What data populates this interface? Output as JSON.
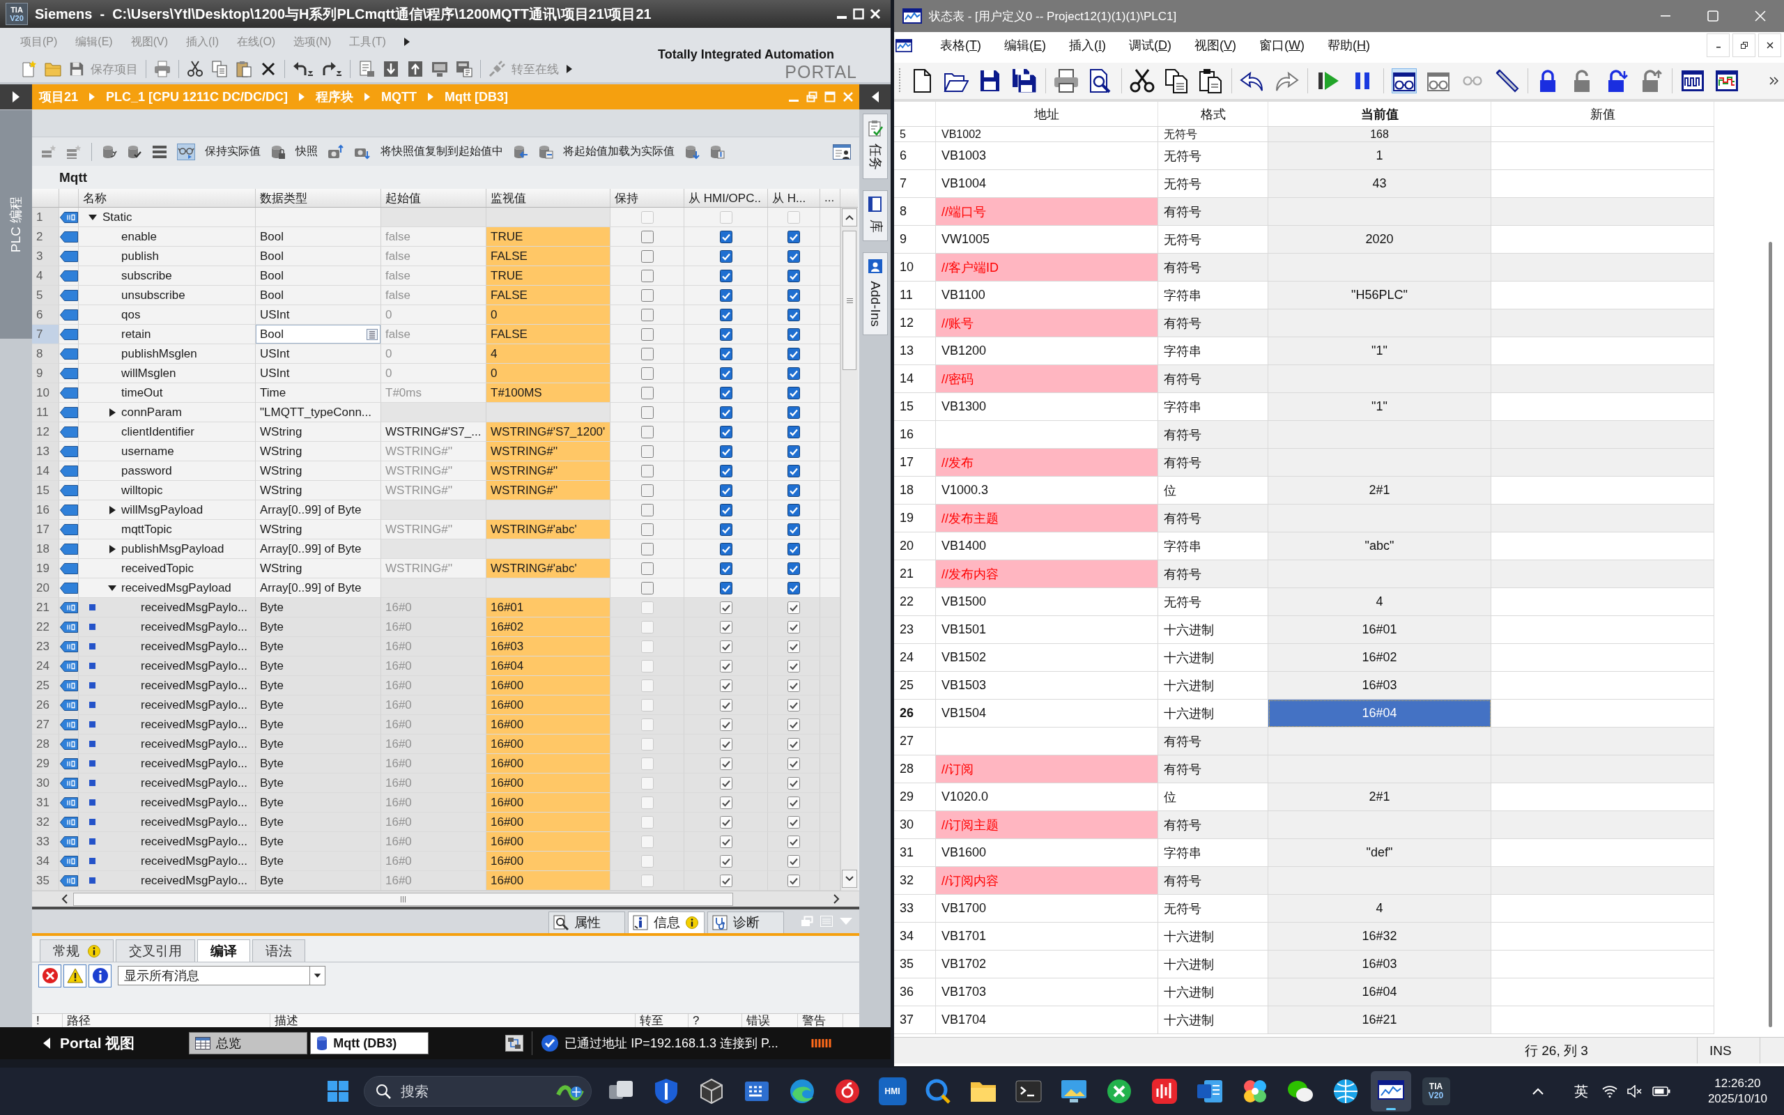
{
  "left_window": {
    "logo_lines": [
      "TIA",
      "V20"
    ],
    "title": "Siemens  -  C:\\Users\\Ytl\\Desktop\\1200与H系列PLCmqtt通信\\程序\\1200MQTT通讯\\项目21\\项目21",
    "menu": [
      "项目(P)",
      "编辑(E)",
      "视图(V)",
      "插入(I)",
      "在线(O)",
      "选项(N)",
      "工具(T)"
    ],
    "toolbar": {
      "save_project": "保存项目",
      "go_online": "转至在线"
    },
    "brand": [
      "Totally Integrated Automation",
      "PORTAL"
    ],
    "side_tab": "PLC 编程",
    "breadcrumb": [
      "项目21",
      "PLC_1 [CPU 1211C DC/DC/DC]",
      "程序块",
      "MQTT",
      "Mqtt [DB3]"
    ],
    "task_tabs": [
      "任务",
      "库",
      "Add-Ins"
    ],
    "db_toolbar": {
      "monitoring": true,
      "labels": [
        "保持实际值",
        "快照",
        "将快照值复制到起始值中",
        "将起始值加载为实际值"
      ]
    },
    "block_name": "Mqtt",
    "table": {
      "columns": [
        "名称",
        "数据类型",
        "起始值",
        "监视值",
        "保持",
        "从 HMI/OPC..",
        "从 H...",
        "..."
      ],
      "rows": [
        {
          "number": "1",
          "name": "Static",
          "expanded": true,
          "retain": false,
          "from_hmi_opc": false,
          "from_h": false,
          "editable": false,
          "selected": false,
          "children": [
            {
              "number": "2",
              "name": "enable",
              "data_type": "Bool",
              "start": "false",
              "start_default": true,
              "monitor": "TRUE",
              "retain": false,
              "from_hmi_opc": true,
              "from_h": true,
              "editable": true,
              "selected": false
            },
            {
              "number": "3",
              "name": "publish",
              "data_type": "Bool",
              "start": "false",
              "start_default": true,
              "monitor": "FALSE",
              "retain": false,
              "from_hmi_opc": true,
              "from_h": true,
              "editable": true,
              "selected": false
            },
            {
              "number": "4",
              "name": "subscribe",
              "data_type": "Bool",
              "start": "false",
              "start_default": true,
              "monitor": "TRUE",
              "retain": false,
              "from_hmi_opc": true,
              "from_h": true,
              "editable": true,
              "selected": false
            },
            {
              "number": "5",
              "name": "unsubscribe",
              "data_type": "Bool",
              "start": "false",
              "start_default": true,
              "monitor": "FALSE",
              "retain": false,
              "from_hmi_opc": true,
              "from_h": true,
              "editable": true,
              "selected": false
            },
            {
              "number": "6",
              "name": "qos",
              "data_type": "USInt",
              "start": "0",
              "start_default": true,
              "monitor": "0",
              "retain": false,
              "from_hmi_opc": true,
              "from_h": true,
              "editable": true,
              "selected": false
            },
            {
              "number": "7",
              "name": "retain",
              "data_type": "Bool",
              "start": "false",
              "start_default": true,
              "monitor": "FALSE",
              "retain": false,
              "from_hmi_opc": true,
              "from_h": true,
              "editable": true,
              "selected": true
            },
            {
              "number": "8",
              "name": "publishMsglen",
              "data_type": "USInt",
              "start": "0",
              "start_default": true,
              "monitor": "4",
              "retain": false,
              "from_hmi_opc": true,
              "from_h": true,
              "editable": true,
              "selected": false
            },
            {
              "number": "9",
              "name": "willMsglen",
              "data_type": "USInt",
              "start": "0",
              "start_default": true,
              "monitor": "0",
              "retain": false,
              "from_hmi_opc": true,
              "from_h": true,
              "editable": true,
              "selected": false
            },
            {
              "number": "10",
              "name": "timeOut",
              "data_type": "Time",
              "start": "T#0ms",
              "start_default": true,
              "monitor": "T#100MS",
              "retain": false,
              "from_hmi_opc": true,
              "from_h": true,
              "editable": true,
              "selected": false
            },
            {
              "number": "11",
              "name": "connParam",
              "expanded": false,
              "data_type": "\"LMQTT_typeConn...",
              "retain": false,
              "from_hmi_opc": true,
              "from_h": true,
              "editable": true,
              "selected": false
            },
            {
              "number": "12",
              "name": "clientIdentifier",
              "data_type": "WString",
              "start": "WSTRING#'S7_...",
              "start_default": false,
              "monitor": "WSTRING#'S7_1200'",
              "retain": false,
              "from_hmi_opc": true,
              "from_h": true,
              "editable": true,
              "selected": false
            },
            {
              "number": "13",
              "name": "username",
              "data_type": "WString",
              "start": "WSTRING#''",
              "start_default": true,
              "monitor": "WSTRING#''",
              "retain": false,
              "from_hmi_opc": true,
              "from_h": true,
              "editable": true,
              "selected": false
            },
            {
              "number": "14",
              "name": "password",
              "data_type": "WString",
              "start": "WSTRING#''",
              "start_default": true,
              "monitor": "WSTRING#''",
              "retain": false,
              "from_hmi_opc": true,
              "from_h": true,
              "editable": true,
              "selected": false
            },
            {
              "number": "15",
              "name": "willtopic",
              "data_type": "WString",
              "start": "WSTRING#''",
              "start_default": true,
              "monitor": "WSTRING#''",
              "retain": false,
              "from_hmi_opc": true,
              "from_h": true,
              "editable": true,
              "selected": false
            },
            {
              "number": "16",
              "name": "willMsgPayload",
              "expanded": false,
              "data_type": "Array[0..99] of Byte",
              "retain": false,
              "from_hmi_opc": true,
              "from_h": true,
              "editable": true,
              "selected": false
            },
            {
              "number": "17",
              "name": "mqttTopic",
              "data_type": "WString",
              "start": "WSTRING#''",
              "start_default": true,
              "monitor": "WSTRING#'abc'",
              "retain": false,
              "from_hmi_opc": true,
              "from_h": true,
              "editable": true,
              "selected": false
            },
            {
              "number": "18",
              "name": "publishMsgPayload",
              "expanded": false,
              "data_type": "Array[0..99] of Byte",
              "retain": false,
              "from_hmi_opc": true,
              "from_h": true,
              "editable": true,
              "selected": false
            },
            {
              "number": "19",
              "name": "receivedTopic",
              "data_type": "WString",
              "start": "WSTRING#''",
              "start_default": true,
              "monitor": "WSTRING#'abc'",
              "retain": false,
              "from_hmi_opc": true,
              "from_h": true,
              "editable": true,
              "selected": false
            },
            {
              "number": "20",
              "name": "receivedMsgPayload",
              "expanded": true,
              "data_type": "Array[0..99] of Byte",
              "retain": false,
              "from_hmi_opc": true,
              "from_h": true,
              "editable": true,
              "selected": false,
              "children": [
                {
                  "number": "21",
                  "name": "receivedMsgPaylo...",
                  "data_type": "Byte",
                  "start": "16#0",
                  "start_default": true,
                  "monitor": "16#01",
                  "retain": false,
                  "from_hmi_opc": true,
                  "from_h": true,
                  "editable": false,
                  "selected": false
                },
                {
                  "number": "22",
                  "name": "receivedMsgPaylo...",
                  "data_type": "Byte",
                  "start": "16#0",
                  "start_default": true,
                  "monitor": "16#02",
                  "retain": false,
                  "from_hmi_opc": true,
                  "from_h": true,
                  "editable": false,
                  "selected": false
                },
                {
                  "number": "23",
                  "name": "receivedMsgPaylo...",
                  "data_type": "Byte",
                  "start": "16#0",
                  "start_default": true,
                  "monitor": "16#03",
                  "retain": false,
                  "from_hmi_opc": true,
                  "from_h": true,
                  "editable": false,
                  "selected": false
                },
                {
                  "number": "24",
                  "name": "receivedMsgPaylo...",
                  "data_type": "Byte",
                  "start": "16#0",
                  "start_default": true,
                  "monitor": "16#04",
                  "retain": false,
                  "from_hmi_opc": true,
                  "from_h": true,
                  "editable": false,
                  "selected": false
                },
                {
                  "number": "25",
                  "name": "receivedMsgPaylo...",
                  "data_type": "Byte",
                  "start": "16#0",
                  "start_default": true,
                  "monitor": "16#00",
                  "retain": false,
                  "from_hmi_opc": true,
                  "from_h": true,
                  "editable": false,
                  "selected": false
                },
                {
                  "number": "26",
                  "name": "receivedMsgPaylo...",
                  "data_type": "Byte",
                  "start": "16#0",
                  "start_default": true,
                  "monitor": "16#00",
                  "retain": false,
                  "from_hmi_opc": true,
                  "from_h": true,
                  "editable": false,
                  "selected": false
                },
                {
                  "number": "27",
                  "name": "receivedMsgPaylo...",
                  "data_type": "Byte",
                  "start": "16#0",
                  "start_default": true,
                  "monitor": "16#00",
                  "retain": false,
                  "from_hmi_opc": true,
                  "from_h": true,
                  "editable": false,
                  "selected": false
                },
                {
                  "number": "28",
                  "name": "receivedMsgPaylo...",
                  "data_type": "Byte",
                  "start": "16#0",
                  "start_default": true,
                  "monitor": "16#00",
                  "retain": false,
                  "from_hmi_opc": true,
                  "from_h": true,
                  "editable": false,
                  "selected": false
                },
                {
                  "number": "29",
                  "name": "receivedMsgPaylo...",
                  "data_type": "Byte",
                  "start": "16#0",
                  "start_default": true,
                  "monitor": "16#00",
                  "retain": false,
                  "from_hmi_opc": true,
                  "from_h": true,
                  "editable": false,
                  "selected": false
                },
                {
                  "number": "30",
                  "name": "receivedMsgPaylo...",
                  "data_type": "Byte",
                  "start": "16#0",
                  "start_default": true,
                  "monitor": "16#00",
                  "retain": false,
                  "from_hmi_opc": true,
                  "from_h": true,
                  "editable": false,
                  "selected": false
                },
                {
                  "number": "31",
                  "name": "receivedMsgPaylo...",
                  "data_type": "Byte",
                  "start": "16#0",
                  "start_default": true,
                  "monitor": "16#00",
                  "retain": false,
                  "from_hmi_opc": true,
                  "from_h": true,
                  "editable": false,
                  "selected": false
                },
                {
                  "number": "32",
                  "name": "receivedMsgPaylo...",
                  "data_type": "Byte",
                  "start": "16#0",
                  "start_default": true,
                  "monitor": "16#00",
                  "retain": false,
                  "from_hmi_opc": true,
                  "from_h": true,
                  "editable": false,
                  "selected": false
                },
                {
                  "number": "33",
                  "name": "receivedMsgPaylo...",
                  "data_type": "Byte",
                  "start": "16#0",
                  "start_default": true,
                  "monitor": "16#00",
                  "retain": false,
                  "from_hmi_opc": true,
                  "from_h": true,
                  "editable": false,
                  "selected": false
                },
                {
                  "number": "34",
                  "name": "receivedMsgPaylo...",
                  "data_type": "Byte",
                  "start": "16#0",
                  "start_default": true,
                  "monitor": "16#00",
                  "retain": false,
                  "from_hmi_opc": true,
                  "from_h": true,
                  "editable": false,
                  "selected": false
                },
                {
                  "number": "35",
                  "name": "receivedMsgPaylo...",
                  "data_type": "Byte",
                  "start": "16#0",
                  "start_default": true,
                  "monitor": "16#00",
                  "retain": false,
                  "from_hmi_opc": true,
                  "from_h": true,
                  "editable": false,
                  "selected": false
                }
              ]
            }
          ]
        }
      ]
    },
    "inspector": {
      "tabs": [
        {
          "label": "属性",
          "selected": false,
          "badge": false
        },
        {
          "label": "信息",
          "selected": true,
          "badge": true
        },
        {
          "label": "诊断",
          "selected": false,
          "badge": false
        }
      ],
      "subtabs": [
        {
          "label": "常规",
          "selected": false,
          "badge": true
        },
        {
          "label": "交叉引用",
          "selected": false,
          "badge": false
        },
        {
          "label": "编译",
          "selected": true,
          "badge": false
        },
        {
          "label": "语法",
          "selected": false,
          "badge": false
        }
      ],
      "filter": "显示所有消息",
      "columns": [
        "!",
        "路径",
        "描述",
        "转至",
        "?",
        "错误",
        "警告"
      ]
    },
    "portal_bar": {
      "portal_view": "Portal 视图",
      "editors": [
        {
          "label": "总览",
          "selected": false
        },
        {
          "label": "Mqtt (DB3)",
          "selected": true
        }
      ],
      "status": "已通过地址 IP=192.168.1.3 连接到 P..."
    }
  },
  "right_window": {
    "title": "状态表 - [用户定义0 -- Project12(1)(1)(1)\\PLC1]",
    "menu": [
      "表格(T)",
      "编辑(E)",
      "插入(I)",
      "调试(D)",
      "视图(V)",
      "窗口(W)",
      "帮助(H)"
    ],
    "toolbar": {
      "monitoring": true
    },
    "table": {
      "columns": [
        "地址",
        "格式",
        "当前值",
        "新值"
      ],
      "rows": [
        {
          "number": "5",
          "kind": "address",
          "address": "VB1002",
          "format": "无符号",
          "value": "168",
          "selected": false
        },
        {
          "number": "6",
          "kind": "address",
          "address": "VB1003",
          "format": "无符号",
          "value": "1",
          "selected": false
        },
        {
          "number": "7",
          "kind": "address",
          "address": "VB1004",
          "format": "无符号",
          "value": "43",
          "selected": false
        },
        {
          "number": "8",
          "kind": "comment",
          "address": "//端口号",
          "format": "有符号",
          "selected": false
        },
        {
          "number": "9",
          "kind": "address",
          "address": "VW1005",
          "format": "无符号",
          "value": "2020",
          "selected": false
        },
        {
          "number": "10",
          "kind": "comment",
          "address": "//客户端ID",
          "format": "有符号",
          "selected": false
        },
        {
          "number": "11",
          "kind": "address",
          "address": "VB1100",
          "format": "字符串",
          "value": "\"H56PLC\"",
          "selected": false
        },
        {
          "number": "12",
          "kind": "comment",
          "address": "//账号",
          "format": "有符号",
          "selected": false
        },
        {
          "number": "13",
          "kind": "address",
          "address": "VB1200",
          "format": "字符串",
          "value": "\"1\"",
          "selected": false
        },
        {
          "number": "14",
          "kind": "comment",
          "address": "//密码",
          "format": "有符号",
          "selected": false
        },
        {
          "number": "15",
          "kind": "address",
          "address": "VB1300",
          "format": "字符串",
          "value": "\"1\"",
          "selected": false
        },
        {
          "number": "16",
          "kind": "blank",
          "format": "有符号",
          "selected": false
        },
        {
          "number": "17",
          "kind": "comment",
          "address": "//发布",
          "format": "有符号",
          "selected": false
        },
        {
          "number": "18",
          "kind": "address",
          "address": "V1000.3",
          "format": "位",
          "value": "2#1",
          "selected": false
        },
        {
          "number": "19",
          "kind": "comment",
          "address": "//发布主题",
          "format": "有符号",
          "selected": false
        },
        {
          "number": "20",
          "kind": "address",
          "address": "VB1400",
          "format": "字符串",
          "value": "\"abc\"",
          "selected": false
        },
        {
          "number": "21",
          "kind": "comment",
          "address": "//发布内容",
          "format": "有符号",
          "selected": false
        },
        {
          "number": "22",
          "kind": "address",
          "address": "VB1500",
          "format": "无符号",
          "value": "4",
          "selected": false
        },
        {
          "number": "23",
          "kind": "address",
          "address": "VB1501",
          "format": "十六进制",
          "value": "16#01",
          "selected": false
        },
        {
          "number": "24",
          "kind": "address",
          "address": "VB1502",
          "format": "十六进制",
          "value": "16#02",
          "selected": false
        },
        {
          "number": "25",
          "kind": "address",
          "address": "VB1503",
          "format": "十六进制",
          "value": "16#03",
          "selected": false
        },
        {
          "number": "26",
          "kind": "address",
          "address": "VB1504",
          "format": "十六进制",
          "value": "16#04",
          "selected": true
        },
        {
          "number": "27",
          "kind": "blank",
          "format": "有符号",
          "selected": false
        },
        {
          "number": "28",
          "kind": "comment",
          "address": "//订阅",
          "format": "有符号",
          "selected": false
        },
        {
          "number": "29",
          "kind": "address",
          "address": "V1020.0",
          "format": "位",
          "value": "2#1",
          "selected": false
        },
        {
          "number": "30",
          "kind": "comment",
          "address": "//订阅主题",
          "format": "有符号",
          "selected": false
        },
        {
          "number": "31",
          "kind": "address",
          "address": "VB1600",
          "format": "字符串",
          "value": "\"def\"",
          "selected": false
        },
        {
          "number": "32",
          "kind": "comment",
          "address": "//订阅内容",
          "format": "有符号",
          "selected": false
        },
        {
          "number": "33",
          "kind": "address",
          "address": "VB1700",
          "format": "无符号",
          "value": "4",
          "selected": false
        },
        {
          "number": "34",
          "kind": "address",
          "address": "VB1701",
          "format": "十六进制",
          "value": "16#32",
          "selected": false
        },
        {
          "number": "35",
          "kind": "address",
          "address": "VB1702",
          "format": "十六进制",
          "value": "16#03",
          "selected": false
        },
        {
          "number": "36",
          "kind": "address",
          "address": "VB1703",
          "format": "十六进制",
          "value": "16#04",
          "selected": false
        },
        {
          "number": "37",
          "kind": "address",
          "address": "VB1704",
          "format": "十六进制",
          "value": "16#21",
          "selected": false
        }
      ]
    },
    "status_bar": {
      "position": "行 26, 列 3",
      "mode": "INS"
    }
  },
  "taskbar": {
    "search_placeholder": "搜索",
    "apps": [
      {
        "selected": false
      },
      {
        "selected": false
      },
      {
        "selected": false
      },
      {
        "selected": false
      },
      {
        "selected": false
      },
      {
        "selected": false
      },
      {
        "selected": false,
        "lines": [
          "HMI"
        ]
      },
      {
        "selected": false
      },
      {
        "selected": false
      },
      {
        "selected": false
      },
      {
        "selected": false
      },
      {
        "selected": false
      },
      {
        "selected": false
      },
      {
        "selected": false
      },
      {
        "selected": false
      },
      {
        "selected": false
      },
      {
        "selected": false
      },
      {
        "selected": true
      },
      {
        "selected": false,
        "lines": [
          "TIA",
          "V20"
        ]
      }
    ],
    "ime": "英",
    "time": "12:26:20",
    "date": "2025/10/10"
  }
}
